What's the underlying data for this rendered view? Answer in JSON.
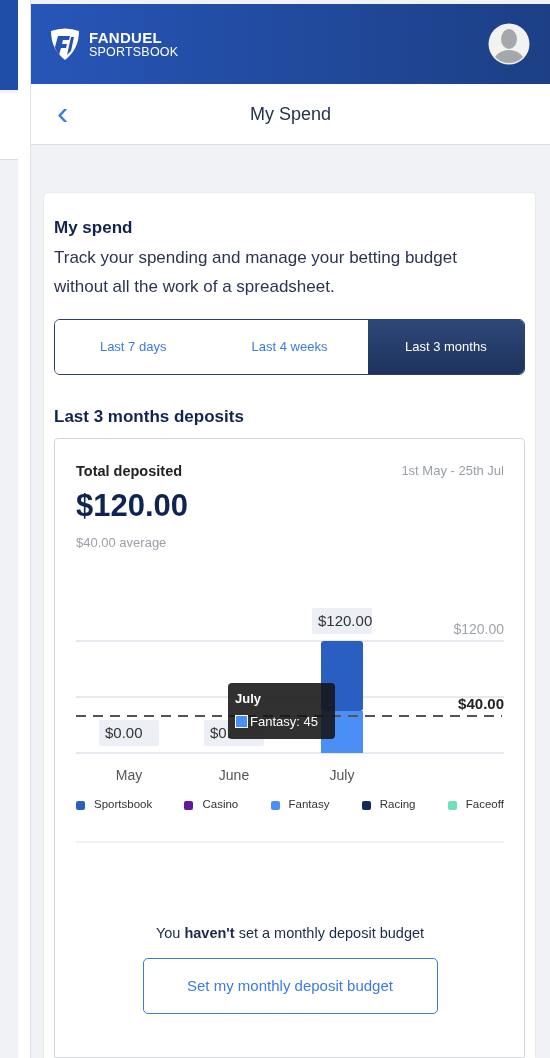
{
  "header": {
    "brand": "FANDUEL",
    "brand_sub": "SPORTSBOOK"
  },
  "title_bar": {
    "back": "‹",
    "title": "My Spend"
  },
  "intro": {
    "heading": "My spend",
    "text": "Track your spending and manage your betting budget without all the work of a spreadsheet."
  },
  "tabs": [
    {
      "label": "Last 7 days",
      "selected": false
    },
    {
      "label": "Last 4 weeks",
      "selected": false
    },
    {
      "label": "Last 3 months",
      "selected": true
    }
  ],
  "section_title": "Last 3 months deposits",
  "summary": {
    "label": "Total deposited",
    "range": "1st May - 25th Jul",
    "total": "$120.00",
    "average": "$40.00 average"
  },
  "chart": {
    "months": [
      "May",
      "June",
      "July"
    ],
    "value_labels": [
      "$0.00",
      "$0.",
      "$120.00"
    ],
    "top_label": "$120.00",
    "average_label": "$40.00",
    "legend": [
      {
        "name": "Sportsbook",
        "color": "#2a5fc2"
      },
      {
        "name": "Casino",
        "color": "#5e1b9e"
      },
      {
        "name": "Fantasy",
        "color": "#4a8ff5"
      },
      {
        "name": "Racing",
        "color": "#13275a"
      },
      {
        "name": "Faceoff",
        "color": "#6ee0b8"
      }
    ],
    "tooltip": {
      "title": "July",
      "text": "Fantasy: 45",
      "color": "#4a8ff5"
    }
  },
  "budget": {
    "text": "You **haven't** set a monthly deposit budget",
    "button": "Set my monthly deposit budget"
  }
}
